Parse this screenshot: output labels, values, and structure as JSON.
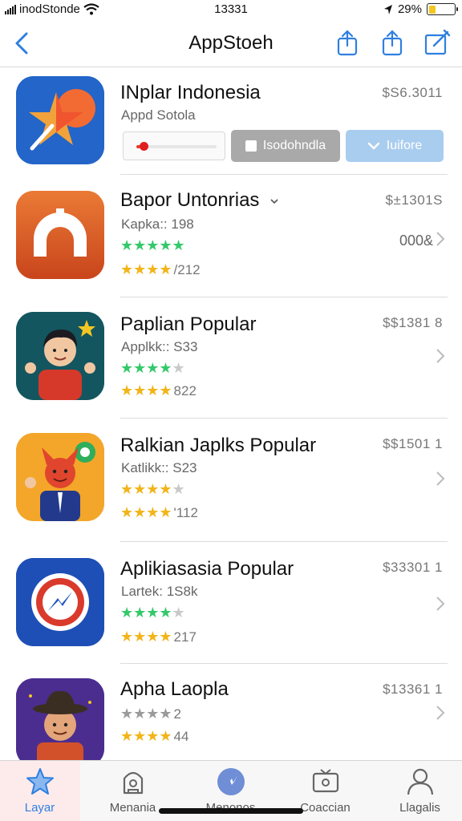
{
  "status_bar": {
    "carrier": "inodStonde",
    "time": "13331",
    "battery_percent": "29%",
    "battery_level": 0.29
  },
  "nav": {
    "title": "AppStoeh",
    "back_icon": "chevron-left-icon",
    "actions": [
      "share-icon",
      "share-icon",
      "compose-icon"
    ]
  },
  "featured": {
    "name": "INplar Indonesia",
    "subtitle": "Appd Sotola",
    "price": "$S6.3011",
    "progress": 0.05,
    "gray_button_label": "Isodohndla",
    "blue_button_label": "Iuifore"
  },
  "apps": [
    {
      "name": "Bapor Untonrias",
      "subtitle": "Kapka:: 198",
      "price": "$±1301S",
      "rating_row1": "★★★★★",
      "rating_row1_empty": "",
      "rating_row2": "★★★★",
      "rating_count": "/212",
      "extra": "000&"
    },
    {
      "name": "Paplian Popular",
      "subtitle": "Applkk:: S33",
      "price": "$$1381 8",
      "rating_row1": "★★★★",
      "rating_row1_empty": "★",
      "rating_row2": "★★★★",
      "rating_count": "822"
    },
    {
      "name": "Ralkian Japlks Popular",
      "subtitle": "Katlikk:: S23",
      "price": "$$1501 1",
      "rating_row1": "★★★★",
      "rating_row1_empty": "★",
      "rating_row2": "★★★★",
      "rating_count": "'112"
    },
    {
      "name": "Aplikiasasia Popular",
      "subtitle": "Lartek: 1S8k",
      "price": "$33301 1",
      "rating_row1": "★★★★",
      "rating_row1_empty": "★",
      "rating_row2": "★★★★",
      "rating_count": "217"
    },
    {
      "name": "Apha Laopla",
      "subtitle": "",
      "price": "$13361 1",
      "rating_row1": "★★★★",
      "rating_row1_empty": "",
      "rating_row1_count": "2",
      "rating_row2": "★★★★",
      "rating_count": "44"
    }
  ],
  "tabs": [
    {
      "label": "Layar",
      "icon": "star-icon"
    },
    {
      "label": "Menania",
      "icon": "bag-icon"
    },
    {
      "label": "Menonos",
      "icon": "compass-icon"
    },
    {
      "label": "Coaccian",
      "icon": "tv-icon"
    },
    {
      "label": "Llagalis",
      "icon": "person-icon"
    }
  ],
  "colors": {
    "accent_blue": "#2f7fe0",
    "star_green": "#33c96a",
    "star_yellow": "#f2b418"
  }
}
